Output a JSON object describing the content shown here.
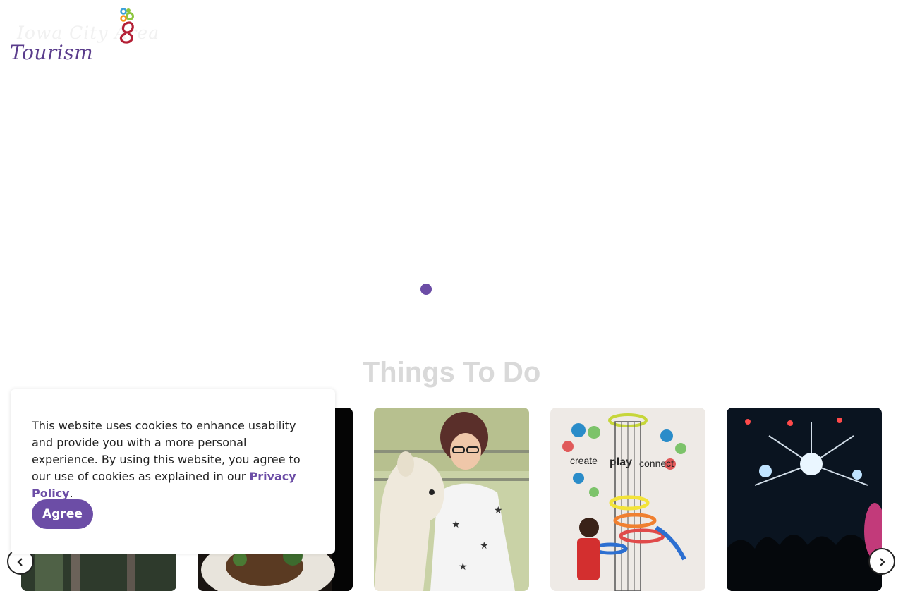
{
  "header": {
    "logo_faint_text": "Iowa City Area",
    "logo_word": "Tourism"
  },
  "hero": {
    "active_slide": 1,
    "slide_count": 1
  },
  "section": {
    "title": "Things To Do"
  },
  "carousel": {
    "cards": [
      {
        "name": "card-outdoors",
        "image": "trees-photo"
      },
      {
        "name": "card-food",
        "image": "food-plate-photo"
      },
      {
        "name": "card-alpaca",
        "image": "girl-with-alpaca-photo"
      },
      {
        "name": "card-museum",
        "image": "child-at-play-exhibit-photo",
        "image_text": [
          "create",
          "play",
          "connect"
        ]
      },
      {
        "name": "card-concert",
        "image": "concert-lights-photo"
      }
    ],
    "prev_icon": "chevron-left-icon",
    "next_icon": "chevron-right-icon"
  },
  "cookie": {
    "text": "This website uses cookies to enhance usability and provide you with a more personal experience. By using this website, you agree to our use of cookies as explained in our ",
    "link_text": "Privacy Policy",
    "text_after": ".",
    "agree_label": "Agree"
  },
  "colors": {
    "brand_purple": "#6c4da6",
    "logo_purple": "#5a3c8c",
    "title_gray": "#d9d9d9"
  }
}
